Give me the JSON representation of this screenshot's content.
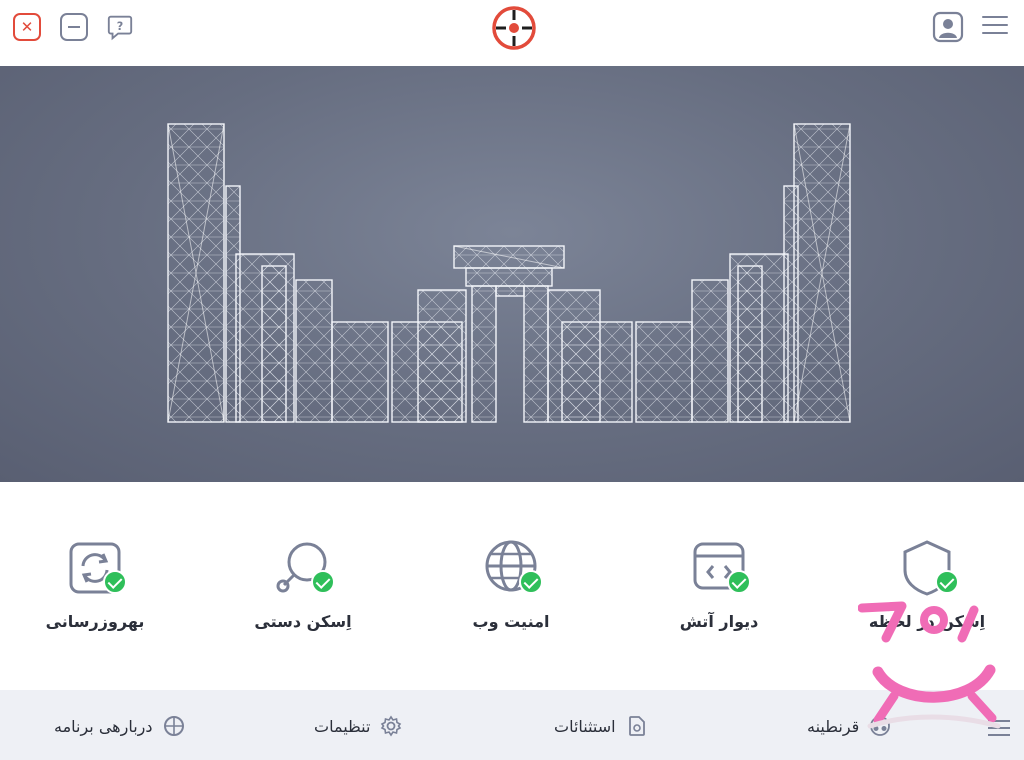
{
  "titlebar": {
    "close_icon": "close-icon",
    "minimize_icon": "minimize-icon",
    "help_icon": "help-chat-icon",
    "logo_icon": "crosshair-logo-icon",
    "profile_icon": "profile-icon",
    "menu_icon": "hamburger-menu-icon"
  },
  "hero": {
    "image": "persepolis-gate-network-illustration"
  },
  "features": [
    {
      "label": "بهروزرسانی",
      "icon": "refresh-icon",
      "status": "enabled"
    },
    {
      "label": "اِسکن دستی",
      "icon": "magnifier-icon",
      "status": "enabled"
    },
    {
      "label": "امنیت وب",
      "icon": "globe-icon",
      "status": "enabled"
    },
    {
      "label": "دیوار آتش",
      "icon": "firewall-browser-icon",
      "status": "enabled"
    },
    {
      "label": "اِسکن در لحظه",
      "icon": "shield-icon",
      "status": "enabled"
    }
  ],
  "bottombar": {
    "about": {
      "label": "دربارهی برنامه",
      "icon": "info-globe-icon"
    },
    "settings": {
      "label": "تنظیمات",
      "icon": "gear-icon"
    },
    "exceptions": {
      "label": "استثنائات",
      "icon": "exception-file-icon"
    },
    "quarantine": {
      "label": "قرنطینه",
      "icon": "biohazard-icon"
    },
    "menu_icon": "hamburger-menu-icon"
  },
  "colors": {
    "accent_red": "#e24b3b",
    "icon_gray": "#7a8197",
    "check_green": "#2fbf5a",
    "bottom_bar": "#eef0f5",
    "watermark_pink": "#f06cb6"
  }
}
